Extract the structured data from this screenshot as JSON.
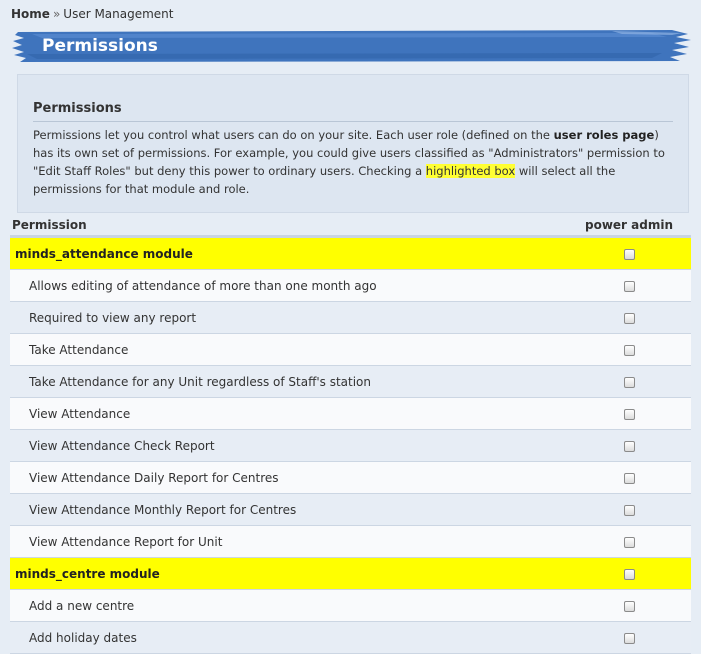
{
  "breadcrumb": {
    "home": "Home",
    "separator": "»",
    "current": "User Management"
  },
  "page_title": "Permissions",
  "help": {
    "title": "Permissions",
    "text_1": "Permissions let you control what users can do on your site. Each user role (defined on the ",
    "link": "user roles page",
    "text_2": ") has its own set of permissions. For example, you could give users classified as \"Administrators\" permission to \"Edit Staff Roles\" but deny this power to ordinary users. Checking a ",
    "highlight": "highlighted box",
    "text_3": " will select all the permissions for that module and role."
  },
  "table": {
    "col_permission": "Permission",
    "col_role": "power admin",
    "rows": [
      {
        "label": "minds_attendance module",
        "module": true,
        "checked": false
      },
      {
        "label": "Allows editing of attendance of more than one month ago",
        "checked": false
      },
      {
        "label": "Required to view any report",
        "checked": false
      },
      {
        "label": "Take Attendance",
        "checked": false
      },
      {
        "label": "Take Attendance for any Unit regardless of Staff's station",
        "checked": false
      },
      {
        "label": "View Attendance",
        "checked": false
      },
      {
        "label": "View Attendance Check Report",
        "checked": false
      },
      {
        "label": "View Attendance Daily Report for Centres",
        "checked": false
      },
      {
        "label": "View Attendance Monthly Report for Centres",
        "checked": false
      },
      {
        "label": "View Attendance Report for Unit",
        "checked": false
      },
      {
        "label": "minds_centre module",
        "module": true,
        "checked": false
      },
      {
        "label": "Add a new centre",
        "checked": false
      },
      {
        "label": "Add holiday dates",
        "checked": false
      }
    ]
  },
  "colors": {
    "banner": "#3f74bd",
    "module_highlight": "#ffff00",
    "page_bg": "#e6edf5"
  }
}
